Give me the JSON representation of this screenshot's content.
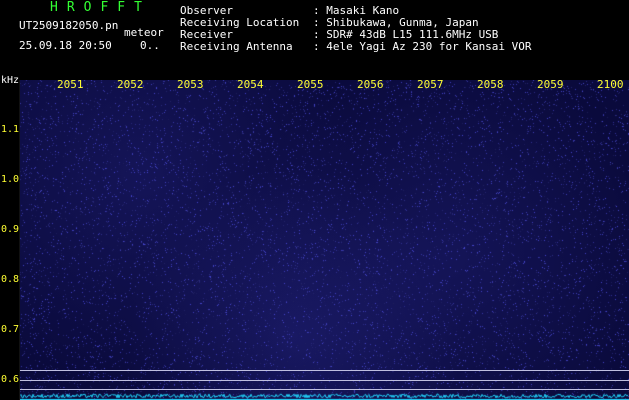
{
  "header": {
    "app_title": "HROFFT",
    "file_name": "UT2509182050.pn",
    "mode": "meteor",
    "date_time": "25.09.18 20:50",
    "count": "0..",
    "info": [
      {
        "label": "Observer",
        "value": ": Masaki Kano"
      },
      {
        "label": "Receiving Location",
        "value": ": Shibukawa, Gunma, Japan"
      },
      {
        "label": "Receiver",
        "value": ": SDR# 43dB L15 111.6MHz USB"
      },
      {
        "label": "Receiving Antenna",
        "value": ": 4ele Yagi Az 230 for Kansai VOR"
      }
    ]
  },
  "axis": {
    "unit": "kHz",
    "x_ticks": [
      "2051",
      "2052",
      "2053",
      "2054",
      "2055",
      "2056",
      "2057",
      "2058",
      "2059",
      "2100"
    ],
    "y_ticks": [
      "1.1",
      "1.0",
      "0.9",
      "0.8",
      "0.7",
      "0.6"
    ]
  },
  "colors": {
    "title": "#33ff33",
    "ticks": "#ffff33",
    "background": "#0a0a3c",
    "spectrum": "#22d8ff"
  }
}
